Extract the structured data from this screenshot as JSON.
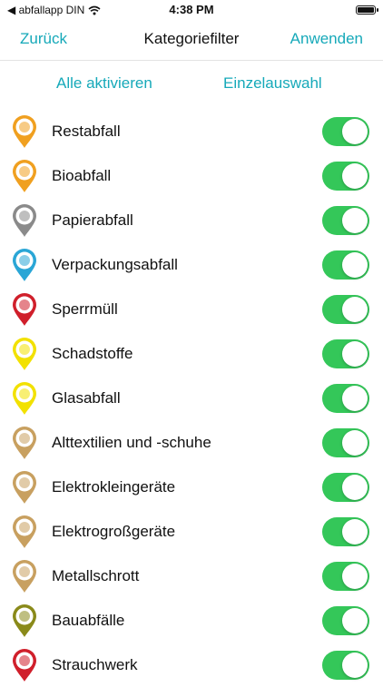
{
  "status": {
    "carrier": "◀ abfallapp DIN",
    "time": "4:38 PM"
  },
  "nav": {
    "back": "Zurück",
    "title": "Kategoriefilter",
    "apply": "Anwenden"
  },
  "segments": {
    "all": "Alle aktivieren",
    "single": "Einzelauswahl"
  },
  "items": [
    {
      "label": "Restabfall",
      "color": "#f0a020",
      "icon": "question-icon",
      "on": true
    },
    {
      "label": "Bioabfall",
      "color": "#f0a020",
      "icon": "question-icon",
      "on": true
    },
    {
      "label": "Papierabfall",
      "color": "#8a8a8a",
      "icon": "paper-icon",
      "on": true
    },
    {
      "label": "Verpackungsabfall",
      "color": "#2aa6d6",
      "icon": "package-icon",
      "on": true
    },
    {
      "label": "Sperrmüll",
      "color": "#d01f2b",
      "icon": "truck-icon",
      "on": true
    },
    {
      "label": "Schadstoffe",
      "color": "#f2e100",
      "icon": "hazard-icon",
      "on": true
    },
    {
      "label": "Glasabfall",
      "color": "#f2e100",
      "icon": "glass-icon",
      "on": true
    },
    {
      "label": "Alttextilien und -schuhe",
      "color": "#c8a060",
      "icon": "textile-icon",
      "on": true
    },
    {
      "label": "Elektrokleingeräte",
      "color": "#c8a060",
      "icon": "electronics-icon",
      "on": true
    },
    {
      "label": "Elektrogroßgeräte",
      "color": "#c8a060",
      "icon": "appliance-icon",
      "on": true
    },
    {
      "label": "Metallschrott",
      "color": "#c8a060",
      "icon": "metal-icon",
      "on": true
    },
    {
      "label": "Bauabfälle",
      "color": "#8a8a1a",
      "icon": "construction-icon",
      "on": true
    },
    {
      "label": "Strauchwerk",
      "color": "#d01f2b",
      "icon": "truck-icon",
      "on": true
    }
  ]
}
